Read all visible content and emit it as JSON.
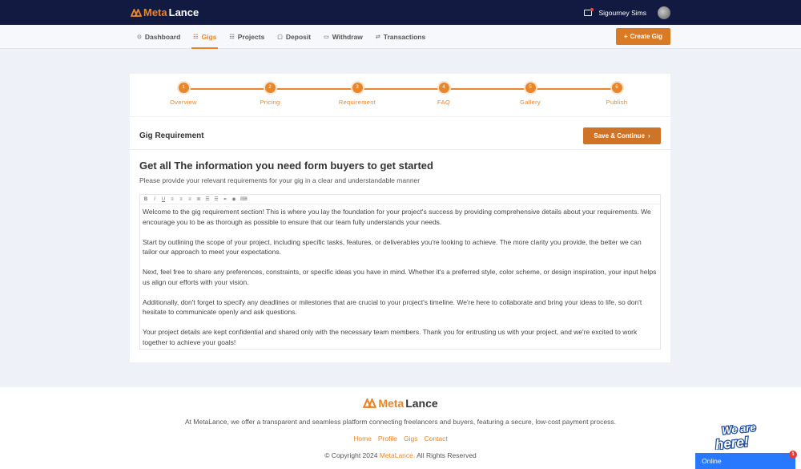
{
  "brand": {
    "prefix": "Meta",
    "suffix": "Lance"
  },
  "user": {
    "name": "Sigourney Sims"
  },
  "nav": [
    {
      "label": "Dashboard",
      "icon": "⊙"
    },
    {
      "label": "Gigs",
      "icon": "☷"
    },
    {
      "label": "Projects",
      "icon": "☷"
    },
    {
      "label": "Deposit",
      "icon": "▢"
    },
    {
      "label": "Withdraw",
      "icon": "▭"
    },
    {
      "label": "Transactions",
      "icon": "⇄"
    }
  ],
  "create_gig": "Create Gig",
  "steps": [
    {
      "num": "1",
      "label": "Overview"
    },
    {
      "num": "2",
      "label": "Pricing"
    },
    {
      "num": "3",
      "label": "Requirement"
    },
    {
      "num": "4",
      "label": "FAQ"
    },
    {
      "num": "5",
      "label": "Gallery"
    },
    {
      "num": "6",
      "label": "Publish"
    }
  ],
  "section": {
    "title": "Gig Requirement",
    "save": "Save & Continue"
  },
  "headline": "Get all The information you need form buyers to get started",
  "subline": "Please provide your relevant requirements for your gig in a clear and understandable manner",
  "editor": {
    "paragraphs": [
      "Welcome to the gig requirement section! This is where you lay the foundation for your project's success by providing comprehensive details about your requirements. We encourage you to be as thorough as possible to ensure that our team fully understands your needs.",
      "Start by outlining the scope of your project, including specific tasks, features, or deliverables you're looking to achieve. The more clarity you provide, the better we can tailor our approach to meet your expectations.",
      "Next, feel free to share any preferences, constraints, or specific ideas you have in mind. Whether it's a preferred style, color scheme, or design inspiration, your input helps us align our efforts with your vision.",
      "Additionally, don't forget to specify any deadlines or milestones that are crucial to your project's timeline. We're here to collaborate and bring your ideas to life, so don't hesitate to communicate openly and ask questions.",
      "Your project details are kept confidential and shared only with the necessary team members. Thank you for entrusting us with your project, and we're excited to work together to achieve your goals!"
    ]
  },
  "footer": {
    "description": "At MetaLance, we offer a transparent and seamless platform connecting freelancers and buyers, featuring a secure, low-cost payment process.",
    "links": [
      "Home",
      "Profile",
      "Gigs",
      "Contact"
    ],
    "copyright_prefix": "© Copyright 2024 ",
    "copyright_brand": "MetaLance.",
    "copyright_suffix": " All Rights Reserved"
  },
  "chat": {
    "we_are": "We are",
    "here": "here!",
    "status": "Online",
    "badge": "1"
  },
  "colors": {
    "accent": "#e8862b",
    "topbar": "#121a42",
    "online": "#2979ff"
  }
}
